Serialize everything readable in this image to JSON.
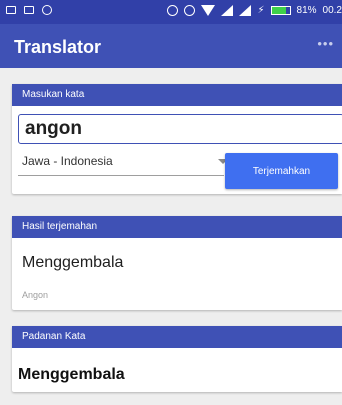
{
  "status_bar": {
    "icons_left": [
      "image-icon",
      "message-icon",
      "info-icon"
    ],
    "icons_right": [
      "dnd-icon",
      "alarm-icon",
      "wifi-icon",
      "signal-icon",
      "signal-icon",
      "charging-icon"
    ],
    "battery_percent_text": "81%",
    "battery_level": 0.81,
    "time": "00.2"
  },
  "appbar": {
    "title": "Translator",
    "menu_icon": "more-icon",
    "color": "#3f51b5"
  },
  "input_card": {
    "header": "Masukan kata",
    "input_value": "angon",
    "language_selected": "Jawa - Indonesia",
    "translate_button": "Terjemahkan"
  },
  "result_card": {
    "header": "Hasil terjemahan",
    "result": "Menggembala",
    "source_word": "Angon"
  },
  "equivalent_card": {
    "header": "Padanan Kata",
    "word": "Menggembala"
  },
  "colors": {
    "primary": "#3f51b5",
    "button": "#3f6ff0",
    "battery": "#3fd04a"
  }
}
